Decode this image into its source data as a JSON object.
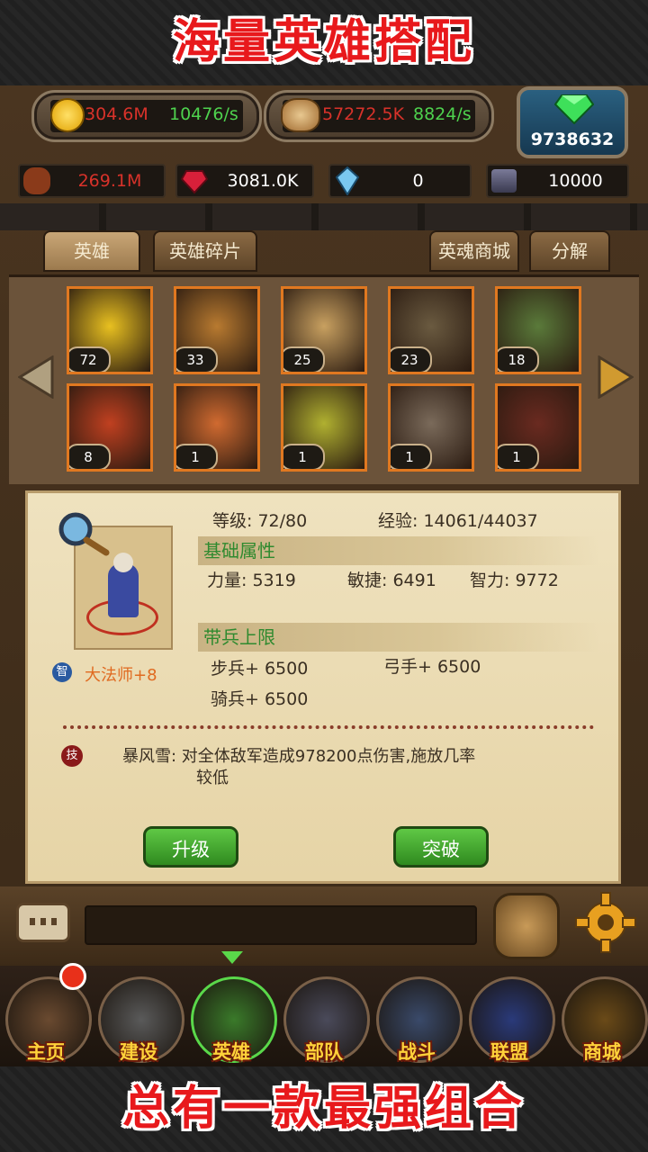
{
  "promo": {
    "top_text": "海量英雄搭配",
    "bottom_text": "总有一款最强组合"
  },
  "resources": {
    "gold_total": "304.6M",
    "gold_rate": "10476/s",
    "wood_total": "57272.5K",
    "wood_rate": "8824/s",
    "gems": "9738632",
    "horse": "269.1M",
    "ruby": "3081.0K",
    "crystal": "0",
    "ore": "10000"
  },
  "tabs": {
    "heroes": "英雄",
    "hero_shards": "英雄碎片",
    "soul_shop": "英魂商城",
    "decompose": "分解"
  },
  "heroes": [
    {
      "level": "72",
      "icon": "wizard-hero-icon",
      "bg": "#e8c020"
    },
    {
      "level": "33",
      "icon": "panda-hero-icon",
      "bg": "#b87a30"
    },
    {
      "level": "25",
      "icon": "hooded-elf-hero-icon",
      "bg": "#c8a060"
    },
    {
      "level": "23",
      "icon": "orc-hero-icon",
      "bg": "#6a5a40"
    },
    {
      "level": "18",
      "icon": "medusa-hero-icon",
      "bg": "#5a7a3a"
    },
    {
      "level": "8",
      "icon": "minotaur-hero-icon",
      "bg": "#c04020"
    },
    {
      "level": "1",
      "icon": "dwarf-helm-hero-icon",
      "bg": "#d06a30"
    },
    {
      "level": "1",
      "icon": "armored-warrior-hero-icon",
      "bg": "#b0b030"
    },
    {
      "level": "1",
      "icon": "purple-goblin-hero-icon",
      "bg": "#7a6a5a"
    },
    {
      "level": "1",
      "icon": "red-demon-hero-icon",
      "bg": "#6a2a20"
    }
  ],
  "detail": {
    "level": "等级: 72/80",
    "exp": "经验: 14061/44037",
    "basic_attr_title": "基础属性",
    "strength": "力量: 5319",
    "agility": "敏捷: 6491",
    "intelligence": "智力: 9772",
    "troop_title": "带兵上限",
    "infantry": "步兵+ 6500",
    "archer": "弓手+ 6500",
    "cavalry": "骑兵+ 6500",
    "int_badge": "智",
    "class_name": "大法师+8",
    "skill_badge": "技",
    "skill_name": "暴风雪",
    "skill_desc_line1": "暴风雪: 对全体敌军造成978200点伤害,施放几率",
    "skill_desc_line2": "较低",
    "upgrade_label": "升级",
    "breakthrough_label": "突破"
  },
  "nav": [
    {
      "label": "主页",
      "icon": "flag-icon"
    },
    {
      "label": "建设",
      "icon": "hammer-icon"
    },
    {
      "label": "英雄",
      "icon": "spartan-helmet-icon"
    },
    {
      "label": "部队",
      "icon": "soldier-shield-icon"
    },
    {
      "label": "战斗",
      "icon": "crossed-swords-icon"
    },
    {
      "label": "联盟",
      "icon": "alliance-banner-icon"
    },
    {
      "label": "商城",
      "icon": "treasure-chest-icon"
    }
  ]
}
